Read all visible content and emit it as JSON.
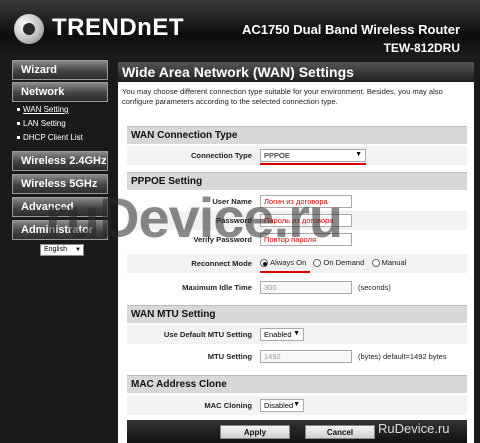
{
  "header": {
    "brand": "TRENDnET",
    "product": "AC1750 Dual Band Wireless Router",
    "model": "TEW-812DRU"
  },
  "sidebar": {
    "items": [
      {
        "label": "Wizard"
      },
      {
        "label": "Network"
      },
      {
        "label": "Wireless 2.4GHz"
      },
      {
        "label": "Wireless 5GHz"
      },
      {
        "label": "Advanced"
      },
      {
        "label": "Administrator"
      }
    ],
    "subitems": [
      {
        "label": "WAN Setting"
      },
      {
        "label": "LAN Setting"
      },
      {
        "label": "DHCP Client List"
      }
    ],
    "language": "English"
  },
  "page": {
    "title": "Wide Area Network (WAN) Settings",
    "description": "You may choose different connection type suitable for your environment. Besides, you may also configure parameters according to the selected connection type."
  },
  "wan_type": {
    "heading": "WAN Connection Type",
    "label": "Connection Type",
    "value": "PPPOE"
  },
  "pppoe": {
    "heading": "PPPOE Setting",
    "user_label": "User Name",
    "user_value": "Логин из договора",
    "password_label": "Password",
    "password_value": "Пароль из договора",
    "verify_label": "Verify Password",
    "verify_value": "Повтор пароля",
    "reconnect_label": "Reconnect Mode",
    "reconnect_options": [
      "Always On",
      "On Demand",
      "Manual"
    ],
    "idle_label": "Maximum Idle Time",
    "idle_value": "300",
    "idle_unit": "(seconds)"
  },
  "mtu": {
    "heading": "WAN MTU Setting",
    "default_label": "Use Default MTU Setting",
    "default_value": "Enabled",
    "mtu_label": "MTU Setting",
    "mtu_value": "1492",
    "mtu_hint": "(bytes) default=1492 bytes"
  },
  "mac": {
    "heading": "MAC Address Clone",
    "cloning_label": "MAC Cloning",
    "cloning_value": "Disabled"
  },
  "buttons": {
    "apply": "Apply",
    "cancel": "Cancel"
  },
  "watermark": {
    "big": "ruDevice.ru",
    "small": "RuDevice.ru"
  },
  "colors": {
    "accent_red": "#dd0000",
    "section_bg": "#d8d8d8",
    "header_bg": "#1f1f1f"
  }
}
